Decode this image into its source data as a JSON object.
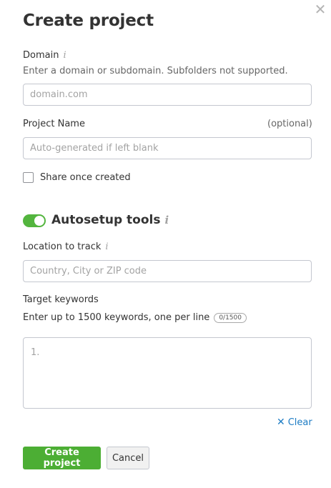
{
  "dialog": {
    "title": "Create project",
    "close_icon": "close-icon"
  },
  "domain": {
    "label": "Domain",
    "info_icon": "info-icon",
    "help": "Enter a domain or subdomain. Subfolders not supported.",
    "placeholder": "domain.com",
    "value": ""
  },
  "project_name": {
    "label": "Project Name",
    "optional": "(optional)",
    "placeholder": "Auto-generated if left blank",
    "value": ""
  },
  "share": {
    "label": "Share once created",
    "checked": false
  },
  "autosetup": {
    "label": "Autosetup tools",
    "enabled": true,
    "info_icon": "info-icon",
    "toggle_color": "#53b53e"
  },
  "location": {
    "label": "Location to track",
    "info_icon": "info-icon",
    "placeholder": "Country, City or ZIP code",
    "value": ""
  },
  "keywords": {
    "label": "Target keywords",
    "help": "Enter up to 1500 keywords, one per line",
    "counter": "0/1500",
    "placeholder": "1.",
    "value": ""
  },
  "clear": {
    "label": "Clear",
    "icon": "x-icon",
    "color": "#1d7cc4"
  },
  "actions": {
    "create_label": "Create project",
    "cancel_label": "Cancel",
    "primary_color": "#4cae34"
  }
}
